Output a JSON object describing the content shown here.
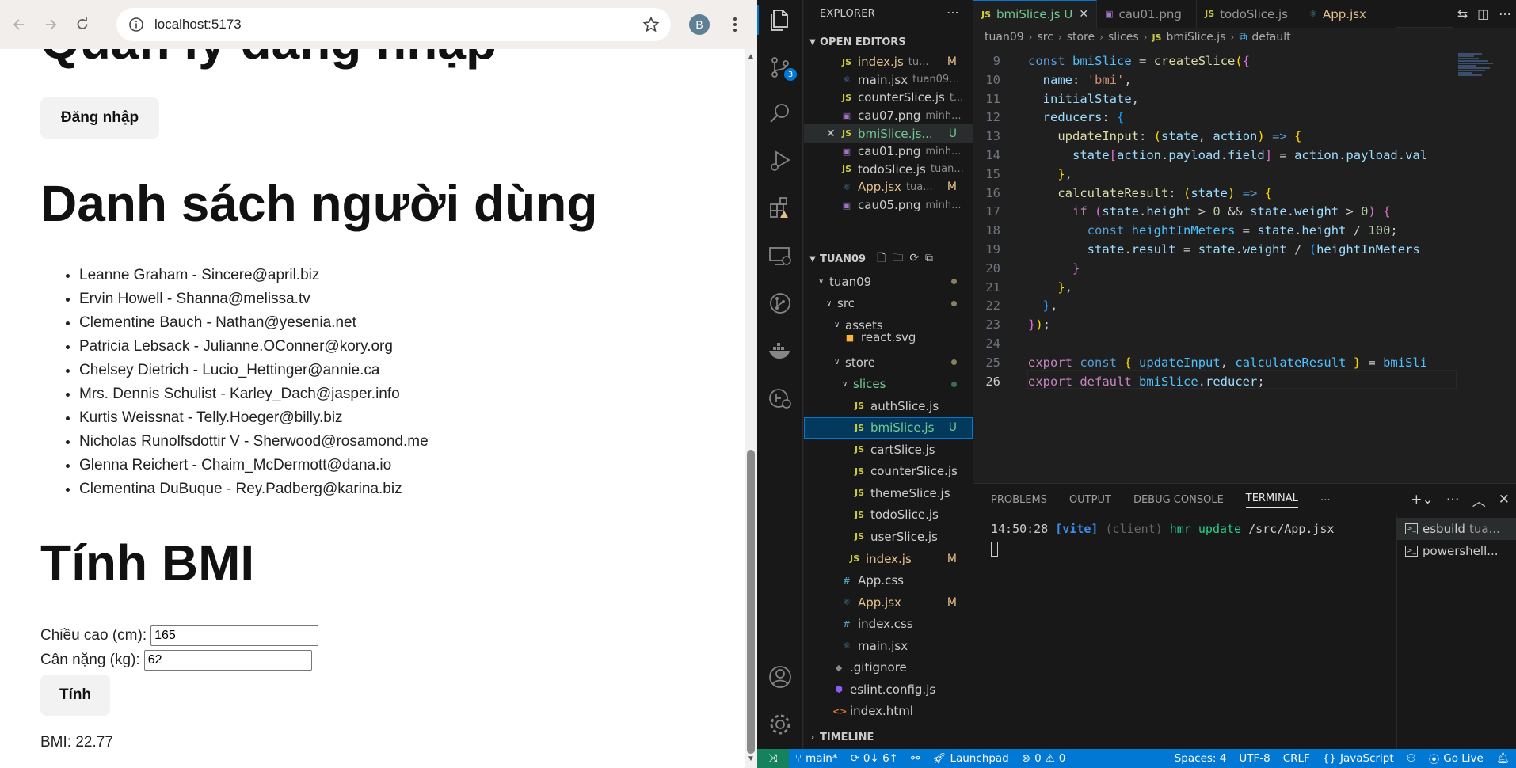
{
  "browser": {
    "url": "localhost:5173",
    "profile_initial": "B",
    "page": {
      "login_heading": "Quản lý đăng nhập",
      "login_button": "Đăng nhập",
      "users_heading": "Danh sách người dùng",
      "users": [
        "Leanne Graham - Sincere@april.biz",
        "Ervin Howell - Shanna@melissa.tv",
        "Clementine Bauch - Nathan@yesenia.net",
        "Patricia Lebsack - Julianne.OConner@kory.org",
        "Chelsey Dietrich - Lucio_Hettinger@annie.ca",
        "Mrs. Dennis Schulist - Karley_Dach@jasper.info",
        "Kurtis Weissnat - Telly.Hoeger@billy.biz",
        "Nicholas Runolfsdottir V - Sherwood@rosamond.me",
        "Glenna Reichert - Chaim_McDermott@dana.io",
        "Clementina DuBuque - Rey.Padberg@karina.biz"
      ],
      "bmi_heading": "Tính BMI",
      "height_label": "Chiều cao (cm):",
      "height_value": "165",
      "weight_label": "Cân nặng (kg):",
      "weight_value": "62",
      "calc_button": "Tính",
      "bmi_result": "BMI: 22.77"
    }
  },
  "vscode": {
    "activity_bar": {
      "scm_badge": "3"
    },
    "explorer": {
      "title": "EXPLORER",
      "open_editors_label": "OPEN EDITORS",
      "open_editors": [
        {
          "name": "index.js",
          "desc": "tu...",
          "status": "M",
          "icon": "JS"
        },
        {
          "name": "main.jsx",
          "desc": "tuan09\\...",
          "status": "",
          "icon": "react"
        },
        {
          "name": "counterSlice.js",
          "desc": "t...",
          "status": "",
          "icon": "JS"
        },
        {
          "name": "cau07.png",
          "desc": "minh...",
          "status": "",
          "icon": "png"
        },
        {
          "name": "bmiSlice.js...",
          "desc": "",
          "status": "U",
          "icon": "JS"
        },
        {
          "name": "cau01.png",
          "desc": "minh...",
          "status": "",
          "icon": "png"
        },
        {
          "name": "todoSlice.js",
          "desc": "tuan...",
          "status": "",
          "icon": "JS"
        },
        {
          "name": "App.jsx",
          "desc": "tua...",
          "status": "M",
          "icon": "react"
        },
        {
          "name": "cau05.png",
          "desc": "minh...",
          "status": "",
          "icon": "png"
        }
      ],
      "workspace_label": "TUAN09",
      "tree": {
        "root": "tuan09",
        "src": "src",
        "assets": "assets",
        "react_svg": "react.svg",
        "store": "store",
        "slices": "slices",
        "slice_files": [
          "authSlice.js",
          "bmiSlice.js",
          "cartSlice.js",
          "counterSlice.js",
          "themeSlice.js",
          "todoSlice.js",
          "userSlice.js"
        ],
        "store_index": "index.js",
        "app_css": "App.css",
        "app_jsx": "App.jsx",
        "index_css": "index.css",
        "main_jsx": "main.jsx",
        "gitignore": ".gitignore",
        "eslint": "eslint.config.js",
        "index_html": "index.html",
        "status_m": "M",
        "status_u": "U"
      },
      "timeline_label": "TIMELINE"
    },
    "tabs": [
      {
        "name": "bmiSlice.js",
        "status": "U"
      },
      {
        "name": "cau01.png"
      },
      {
        "name": "todoSlice.js"
      },
      {
        "name": "App.jsx"
      }
    ],
    "breadcrumb": [
      "tuan09",
      "src",
      "store",
      "slices",
      "bmiSlice.js",
      "default"
    ],
    "code": {
      "line_numbers": [
        "9",
        "10",
        "11",
        "12",
        "13",
        "14",
        "15",
        "16",
        "17",
        "18",
        "19",
        "20",
        "21",
        "22",
        "23",
        "24",
        "25",
        "26"
      ]
    },
    "panel": {
      "tabs": [
        "PROBLEMS",
        "OUTPUT",
        "DEBUG CONSOLE",
        "TERMINAL"
      ],
      "terminal_time": "14:50:28",
      "terminal_vite": "[vite]",
      "terminal_client": "(client)",
      "terminal_hmr": "hmr update",
      "terminal_path": "/src/App.jsx",
      "terminals": [
        {
          "name": "esbuild",
          "desc": "tua..."
        },
        {
          "name": "powershell...",
          "desc": ""
        }
      ]
    },
    "status_bar": {
      "branch": "main*",
      "sync": "0↓ 6↑",
      "launchpad": "Launchpad",
      "errors": "0",
      "warnings": "0",
      "spaces": "Spaces: 4",
      "encoding": "UTF-8",
      "eol": "CRLF",
      "language": "JavaScript",
      "golive": "Go Live"
    },
    "colors": {
      "accent": "#0078d4",
      "status_bar": "#0078d4",
      "remote": "#16825d"
    }
  }
}
